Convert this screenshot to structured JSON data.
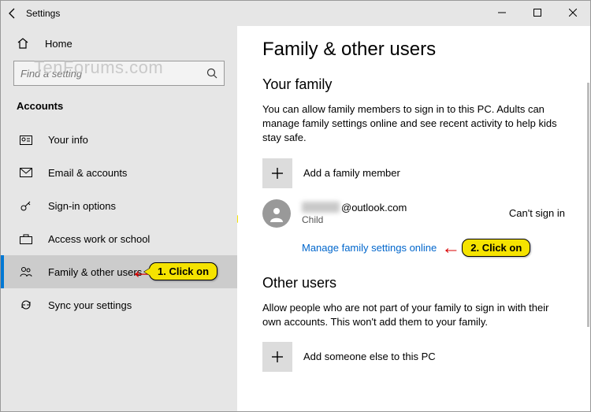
{
  "titlebar": {
    "title": "Settings"
  },
  "sidebar": {
    "home": "Home",
    "search_placeholder": "Find a setting",
    "section": "Accounts",
    "items": [
      {
        "label": "Your info"
      },
      {
        "label": "Email & accounts"
      },
      {
        "label": "Sign-in options"
      },
      {
        "label": "Access work or school"
      },
      {
        "label": "Family & other users"
      },
      {
        "label": "Sync your settings"
      }
    ]
  },
  "content": {
    "heading": "Family & other users",
    "your_family": {
      "title": "Your family",
      "desc": "You can allow family members to sign in to this PC. Adults can manage family settings online and see recent activity to help kids stay safe.",
      "add_label": "Add a family member",
      "member": {
        "email_suffix": "@outlook.com",
        "role": "Child",
        "status": "Can't sign in"
      },
      "manage_link": "Manage family settings online"
    },
    "other_users": {
      "title": "Other users",
      "desc": "Allow people who are not part of your family to sign in with their own accounts. This won't add them to your family.",
      "add_label": "Add someone else to this PC"
    }
  },
  "annotations": {
    "step1": "1. Click on",
    "step2": "2. Click on"
  },
  "watermark": "TenForums.com"
}
